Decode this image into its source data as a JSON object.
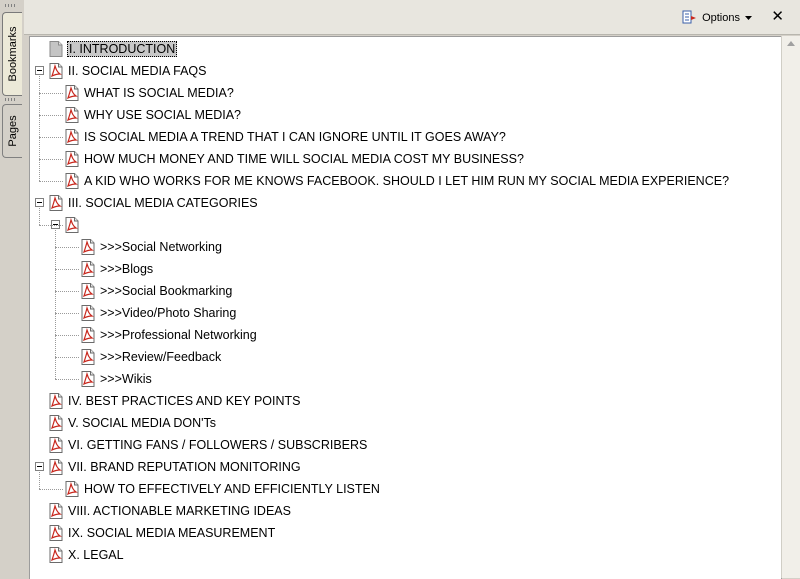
{
  "tabs": {
    "bookmarks": "Bookmarks",
    "pages": "Pages"
  },
  "toolbar": {
    "options_label": "Options",
    "close_label": "✕"
  },
  "bookmarks": [
    {
      "label": "I. INTRODUCTION",
      "level": 0,
      "icon": "gray-bookmark-icon",
      "selected": true
    },
    {
      "label": "II. SOCIAL MEDIA FAQS",
      "level": 0,
      "icon": "pdf-bookmark-icon",
      "expanded": true
    },
    {
      "label": "WHAT IS SOCIAL MEDIA?",
      "level": 1,
      "icon": "pdf-bookmark-icon"
    },
    {
      "label": "WHY USE SOCIAL MEDIA?",
      "level": 1,
      "icon": "pdf-bookmark-icon"
    },
    {
      "label": "IS SOCIAL MEDIA A TREND THAT I CAN IGNORE UNTIL IT GOES AWAY?",
      "level": 1,
      "icon": "pdf-bookmark-icon"
    },
    {
      "label": "HOW MUCH MONEY AND TIME WILL SOCIAL MEDIA COST MY BUSINESS?",
      "level": 1,
      "icon": "pdf-bookmark-icon"
    },
    {
      "label": "A KID WHO WORKS FOR ME KNOWS FACEBOOK.  SHOULD I LET HIM RUN MY SOCIAL MEDIA EXPERIENCE?",
      "level": 1,
      "icon": "pdf-bookmark-icon"
    },
    {
      "label": "III. SOCIAL MEDIA CATEGORIES",
      "level": 0,
      "icon": "pdf-bookmark-icon",
      "expanded": true
    },
    {
      "label": "",
      "level": 1,
      "icon": "pdf-bookmark-icon",
      "expanded": true
    },
    {
      "label": ">>>Social Networking",
      "level": 2,
      "icon": "pdf-bookmark-icon"
    },
    {
      "label": ">>>Blogs",
      "level": 2,
      "icon": "pdf-bookmark-icon"
    },
    {
      "label": ">>>Social Bookmarking",
      "level": 2,
      "icon": "pdf-bookmark-icon"
    },
    {
      "label": ">>>Video/Photo Sharing",
      "level": 2,
      "icon": "pdf-bookmark-icon"
    },
    {
      "label": ">>>Professional Networking",
      "level": 2,
      "icon": "pdf-bookmark-icon"
    },
    {
      "label": ">>>Review/Feedback",
      "level": 2,
      "icon": "pdf-bookmark-icon"
    },
    {
      "label": ">>>Wikis",
      "level": 2,
      "icon": "pdf-bookmark-icon"
    },
    {
      "label": "IV. BEST PRACTICES AND KEY POINTS",
      "level": 0,
      "icon": "pdf-bookmark-icon"
    },
    {
      "label": "V. SOCIAL MEDIA DON'Ts",
      "level": 0,
      "icon": "pdf-bookmark-icon"
    },
    {
      "label": "VI. GETTING FANS / FOLLOWERS / SUBSCRIBERS",
      "level": 0,
      "icon": "pdf-bookmark-icon"
    },
    {
      "label": "VII. BRAND REPUTATION MONITORING",
      "level": 0,
      "icon": "pdf-bookmark-icon",
      "expanded": true
    },
    {
      "label": "HOW TO EFFECTIVELY AND EFFICIENTLY LISTEN",
      "level": 1,
      "icon": "pdf-bookmark-icon"
    },
    {
      "label": "VIII. ACTIONABLE MARKETING IDEAS",
      "level": 0,
      "icon": "pdf-bookmark-icon"
    },
    {
      "label": "IX. SOCIAL MEDIA MEASUREMENT",
      "level": 0,
      "icon": "pdf-bookmark-icon"
    },
    {
      "label": "X. LEGAL",
      "level": 0,
      "icon": "pdf-bookmark-icon"
    }
  ]
}
